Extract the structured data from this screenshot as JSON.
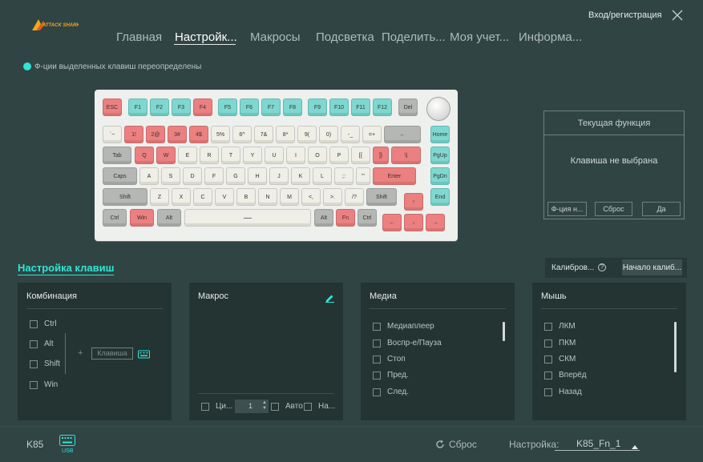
{
  "header": {
    "logo_text": "ATTACK SHARK",
    "login": "Вход/регистрация",
    "tabs": [
      {
        "label": "Главная"
      },
      {
        "label": "Настройк..."
      },
      {
        "label": "Макросы"
      },
      {
        "label": "Подсветка"
      },
      {
        "label": "Поделить..."
      },
      {
        "label": "Моя учет..."
      },
      {
        "label": "Информа..."
      }
    ]
  },
  "legend": {
    "text": "Ф-ции выделенных клавиш переопределены",
    "color": "#2ee6d6"
  },
  "keyboard": {
    "rows": [
      [
        "ESC",
        "F1",
        "F2",
        "F3",
        "F4",
        "F5",
        "F6",
        "F7",
        "F8",
        "F9",
        "F10",
        "F11",
        "F12",
        "Del"
      ],
      [
        "`~",
        "1!",
        "2@",
        "3#",
        "4$",
        "5%",
        "6^",
        "7&",
        "8*",
        "9(",
        "0)",
        "-_",
        "=+",
        "←",
        "Home"
      ],
      [
        "Tab",
        "Q",
        "W",
        "E",
        "R",
        "T",
        "Y",
        "U",
        "I",
        "O",
        "P",
        "[{",
        "]}",
        "\\|",
        "PgUp"
      ],
      [
        "Caps",
        "A",
        "S",
        "D",
        "F",
        "G",
        "H",
        "J",
        "K",
        "L",
        ";:",
        "'\"",
        "Enter",
        "PgDn"
      ],
      [
        "Shift",
        "Z",
        "X",
        "C",
        "V",
        "B",
        "N",
        "M",
        "<,",
        ">.",
        "/?",
        "Shift",
        "↑",
        "End"
      ],
      [
        "Ctrl",
        "Win",
        "Alt",
        "—",
        "Alt",
        "Fn",
        "Ctrl",
        "←",
        "↓",
        "→"
      ]
    ]
  },
  "current_function": {
    "title": "Текущая функция",
    "message": "Клавиша не выбрана",
    "buttons": [
      "Ф-ция н...",
      "Сброс",
      "Да"
    ]
  },
  "section": {
    "title": "Настройка клавиш"
  },
  "calibration": {
    "label": "Калибров...",
    "help": "?",
    "button": "Начало калиб..."
  },
  "panels": {
    "combination": {
      "title": "Комбинация",
      "modifiers": [
        "Ctrl",
        "Alt",
        "Shift",
        "Win"
      ],
      "plus": "+",
      "key_placeholder": "Клавиша"
    },
    "macro": {
      "title": "Макрос",
      "loop_label": "Ци...",
      "count": "1",
      "auto_label": "Авто",
      "third_label": "На..."
    },
    "media": {
      "title": "Медиа",
      "items": [
        "Медиаплеер",
        "Воспр-е/Пауза",
        "Стоп",
        "Пред.",
        "След."
      ]
    },
    "mouse": {
      "title": "Мышь",
      "items": [
        "ЛКМ",
        "ПКМ",
        "СКМ",
        "Вперёд",
        "Назад"
      ]
    }
  },
  "footer": {
    "model": "K85",
    "usb_label": "USB",
    "reset": "Сброс",
    "profile_label": "Настройка:",
    "profile_value": "K85_Fn_1"
  }
}
